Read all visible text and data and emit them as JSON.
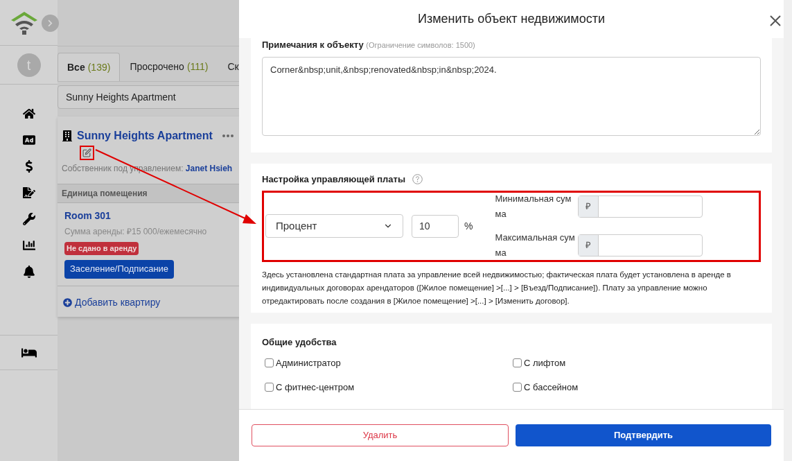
{
  "sidebar": {
    "avatar_letter": "t"
  },
  "tabs": [
    {
      "label": "Все",
      "count": "(139)",
      "selected": true
    },
    {
      "label": "Просрочено",
      "count": "(111)",
      "selected": false
    },
    {
      "label": "Ск",
      "selected": false
    }
  ],
  "search": {
    "value": "Sunny Heights Apartment"
  },
  "property": {
    "title": "Sunny Heights Apartment",
    "owner_label": "Собственник под управлением:",
    "owner_name": "Janet Hsieh",
    "units_header": "Единица помещения",
    "units": [
      {
        "name": "Room 301",
        "rent": "Сумма аренды: ₽15 000/ежемесячно",
        "status": "Не сдано в аренду",
        "action": "Заселение/Подписание"
      }
    ],
    "add_label": "Добавить квартиру"
  },
  "modal": {
    "title": "Изменить объект недвижимости",
    "notes": {
      "label": "Примечания к объекту",
      "hint": "(Ограничение символов: 1500)",
      "value": "Corner&nbsp;unit,&nbsp;renovated&nbsp;in&nbsp;2024."
    },
    "fee": {
      "title": "Настройка управляющей платы",
      "type": "Процент",
      "value": "10",
      "unit": "%",
      "min_label": "Минимальная сумма",
      "max_label": "Максимальная сумма",
      "currency_min": "₽",
      "currency_max": "₽",
      "note": "Здесь установлена стандартная плата за управление всей недвижимостью; фактическая плата будет установлена в аренде в индивидуальных договорах арендаторов ([Жилое помещение] >[...] > [Въезд/Подписание]). Плату за управление можно отредактировать после создания в [Жилое помещение] >[...] > [Изменить договор]."
    },
    "amenities": {
      "title": "Общие удобства",
      "items": [
        {
          "label": "Администратор",
          "checked": false
        },
        {
          "label": "С лифтом",
          "checked": false
        },
        {
          "label": "С фитнес-центром",
          "checked": false
        },
        {
          "label": "С бассейном",
          "checked": false
        }
      ]
    },
    "buttons": {
      "delete": "Удалить",
      "confirm": "Подтвердить"
    }
  }
}
